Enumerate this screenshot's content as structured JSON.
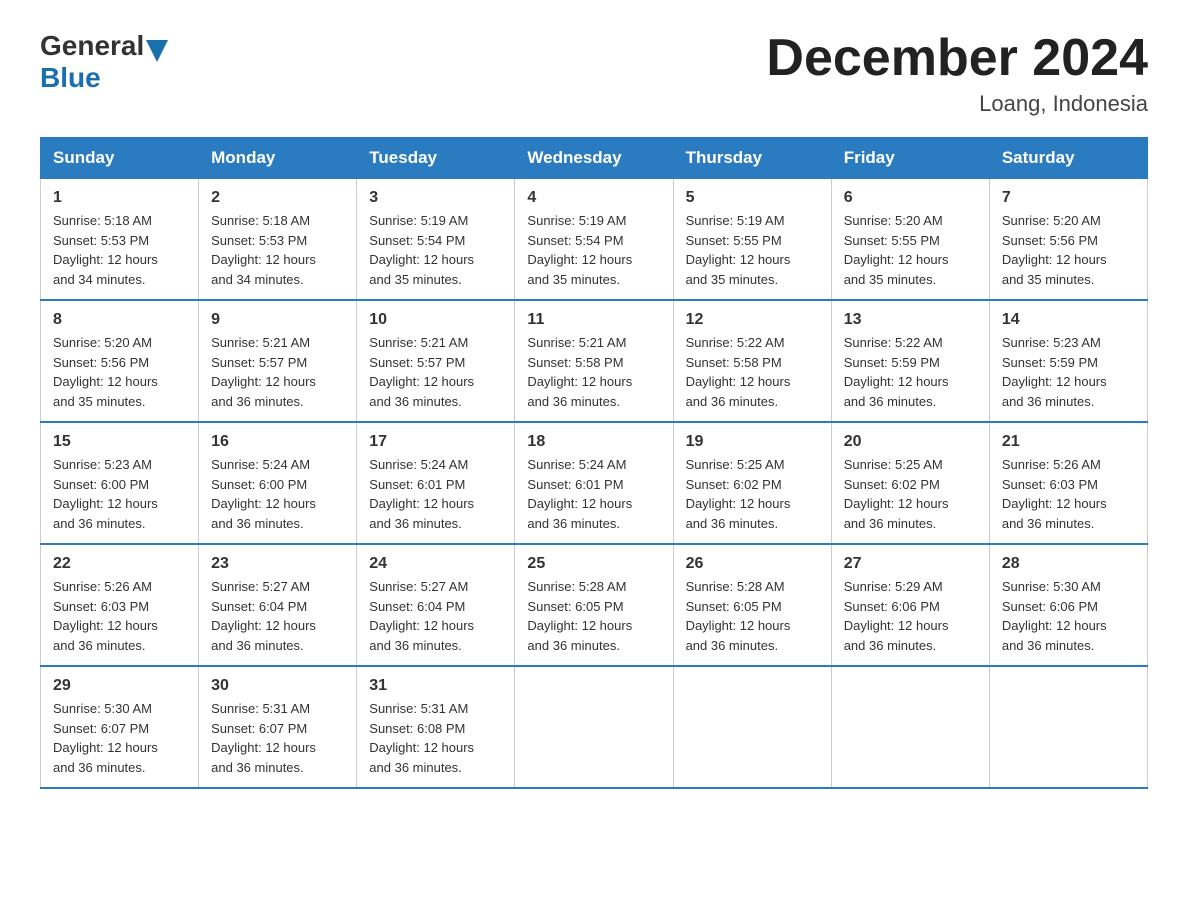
{
  "logo": {
    "text_general": "General",
    "text_blue": "Blue",
    "arrow": "▲"
  },
  "title": {
    "month_year": "December 2024",
    "location": "Loang, Indonesia"
  },
  "headers": [
    "Sunday",
    "Monday",
    "Tuesday",
    "Wednesday",
    "Thursday",
    "Friday",
    "Saturday"
  ],
  "weeks": [
    [
      {
        "day": "1",
        "info": "Sunrise: 5:18 AM\nSunset: 5:53 PM\nDaylight: 12 hours\nand 34 minutes."
      },
      {
        "day": "2",
        "info": "Sunrise: 5:18 AM\nSunset: 5:53 PM\nDaylight: 12 hours\nand 34 minutes."
      },
      {
        "day": "3",
        "info": "Sunrise: 5:19 AM\nSunset: 5:54 PM\nDaylight: 12 hours\nand 35 minutes."
      },
      {
        "day": "4",
        "info": "Sunrise: 5:19 AM\nSunset: 5:54 PM\nDaylight: 12 hours\nand 35 minutes."
      },
      {
        "day": "5",
        "info": "Sunrise: 5:19 AM\nSunset: 5:55 PM\nDaylight: 12 hours\nand 35 minutes."
      },
      {
        "day": "6",
        "info": "Sunrise: 5:20 AM\nSunset: 5:55 PM\nDaylight: 12 hours\nand 35 minutes."
      },
      {
        "day": "7",
        "info": "Sunrise: 5:20 AM\nSunset: 5:56 PM\nDaylight: 12 hours\nand 35 minutes."
      }
    ],
    [
      {
        "day": "8",
        "info": "Sunrise: 5:20 AM\nSunset: 5:56 PM\nDaylight: 12 hours\nand 35 minutes."
      },
      {
        "day": "9",
        "info": "Sunrise: 5:21 AM\nSunset: 5:57 PM\nDaylight: 12 hours\nand 36 minutes."
      },
      {
        "day": "10",
        "info": "Sunrise: 5:21 AM\nSunset: 5:57 PM\nDaylight: 12 hours\nand 36 minutes."
      },
      {
        "day": "11",
        "info": "Sunrise: 5:21 AM\nSunset: 5:58 PM\nDaylight: 12 hours\nand 36 minutes."
      },
      {
        "day": "12",
        "info": "Sunrise: 5:22 AM\nSunset: 5:58 PM\nDaylight: 12 hours\nand 36 minutes."
      },
      {
        "day": "13",
        "info": "Sunrise: 5:22 AM\nSunset: 5:59 PM\nDaylight: 12 hours\nand 36 minutes."
      },
      {
        "day": "14",
        "info": "Sunrise: 5:23 AM\nSunset: 5:59 PM\nDaylight: 12 hours\nand 36 minutes."
      }
    ],
    [
      {
        "day": "15",
        "info": "Sunrise: 5:23 AM\nSunset: 6:00 PM\nDaylight: 12 hours\nand 36 minutes."
      },
      {
        "day": "16",
        "info": "Sunrise: 5:24 AM\nSunset: 6:00 PM\nDaylight: 12 hours\nand 36 minutes."
      },
      {
        "day": "17",
        "info": "Sunrise: 5:24 AM\nSunset: 6:01 PM\nDaylight: 12 hours\nand 36 minutes."
      },
      {
        "day": "18",
        "info": "Sunrise: 5:24 AM\nSunset: 6:01 PM\nDaylight: 12 hours\nand 36 minutes."
      },
      {
        "day": "19",
        "info": "Sunrise: 5:25 AM\nSunset: 6:02 PM\nDaylight: 12 hours\nand 36 minutes."
      },
      {
        "day": "20",
        "info": "Sunrise: 5:25 AM\nSunset: 6:02 PM\nDaylight: 12 hours\nand 36 minutes."
      },
      {
        "day": "21",
        "info": "Sunrise: 5:26 AM\nSunset: 6:03 PM\nDaylight: 12 hours\nand 36 minutes."
      }
    ],
    [
      {
        "day": "22",
        "info": "Sunrise: 5:26 AM\nSunset: 6:03 PM\nDaylight: 12 hours\nand 36 minutes."
      },
      {
        "day": "23",
        "info": "Sunrise: 5:27 AM\nSunset: 6:04 PM\nDaylight: 12 hours\nand 36 minutes."
      },
      {
        "day": "24",
        "info": "Sunrise: 5:27 AM\nSunset: 6:04 PM\nDaylight: 12 hours\nand 36 minutes."
      },
      {
        "day": "25",
        "info": "Sunrise: 5:28 AM\nSunset: 6:05 PM\nDaylight: 12 hours\nand 36 minutes."
      },
      {
        "day": "26",
        "info": "Sunrise: 5:28 AM\nSunset: 6:05 PM\nDaylight: 12 hours\nand 36 minutes."
      },
      {
        "day": "27",
        "info": "Sunrise: 5:29 AM\nSunset: 6:06 PM\nDaylight: 12 hours\nand 36 minutes."
      },
      {
        "day": "28",
        "info": "Sunrise: 5:30 AM\nSunset: 6:06 PM\nDaylight: 12 hours\nand 36 minutes."
      }
    ],
    [
      {
        "day": "29",
        "info": "Sunrise: 5:30 AM\nSunset: 6:07 PM\nDaylight: 12 hours\nand 36 minutes."
      },
      {
        "day": "30",
        "info": "Sunrise: 5:31 AM\nSunset: 6:07 PM\nDaylight: 12 hours\nand 36 minutes."
      },
      {
        "day": "31",
        "info": "Sunrise: 5:31 AM\nSunset: 6:08 PM\nDaylight: 12 hours\nand 36 minutes."
      },
      null,
      null,
      null,
      null
    ]
  ]
}
